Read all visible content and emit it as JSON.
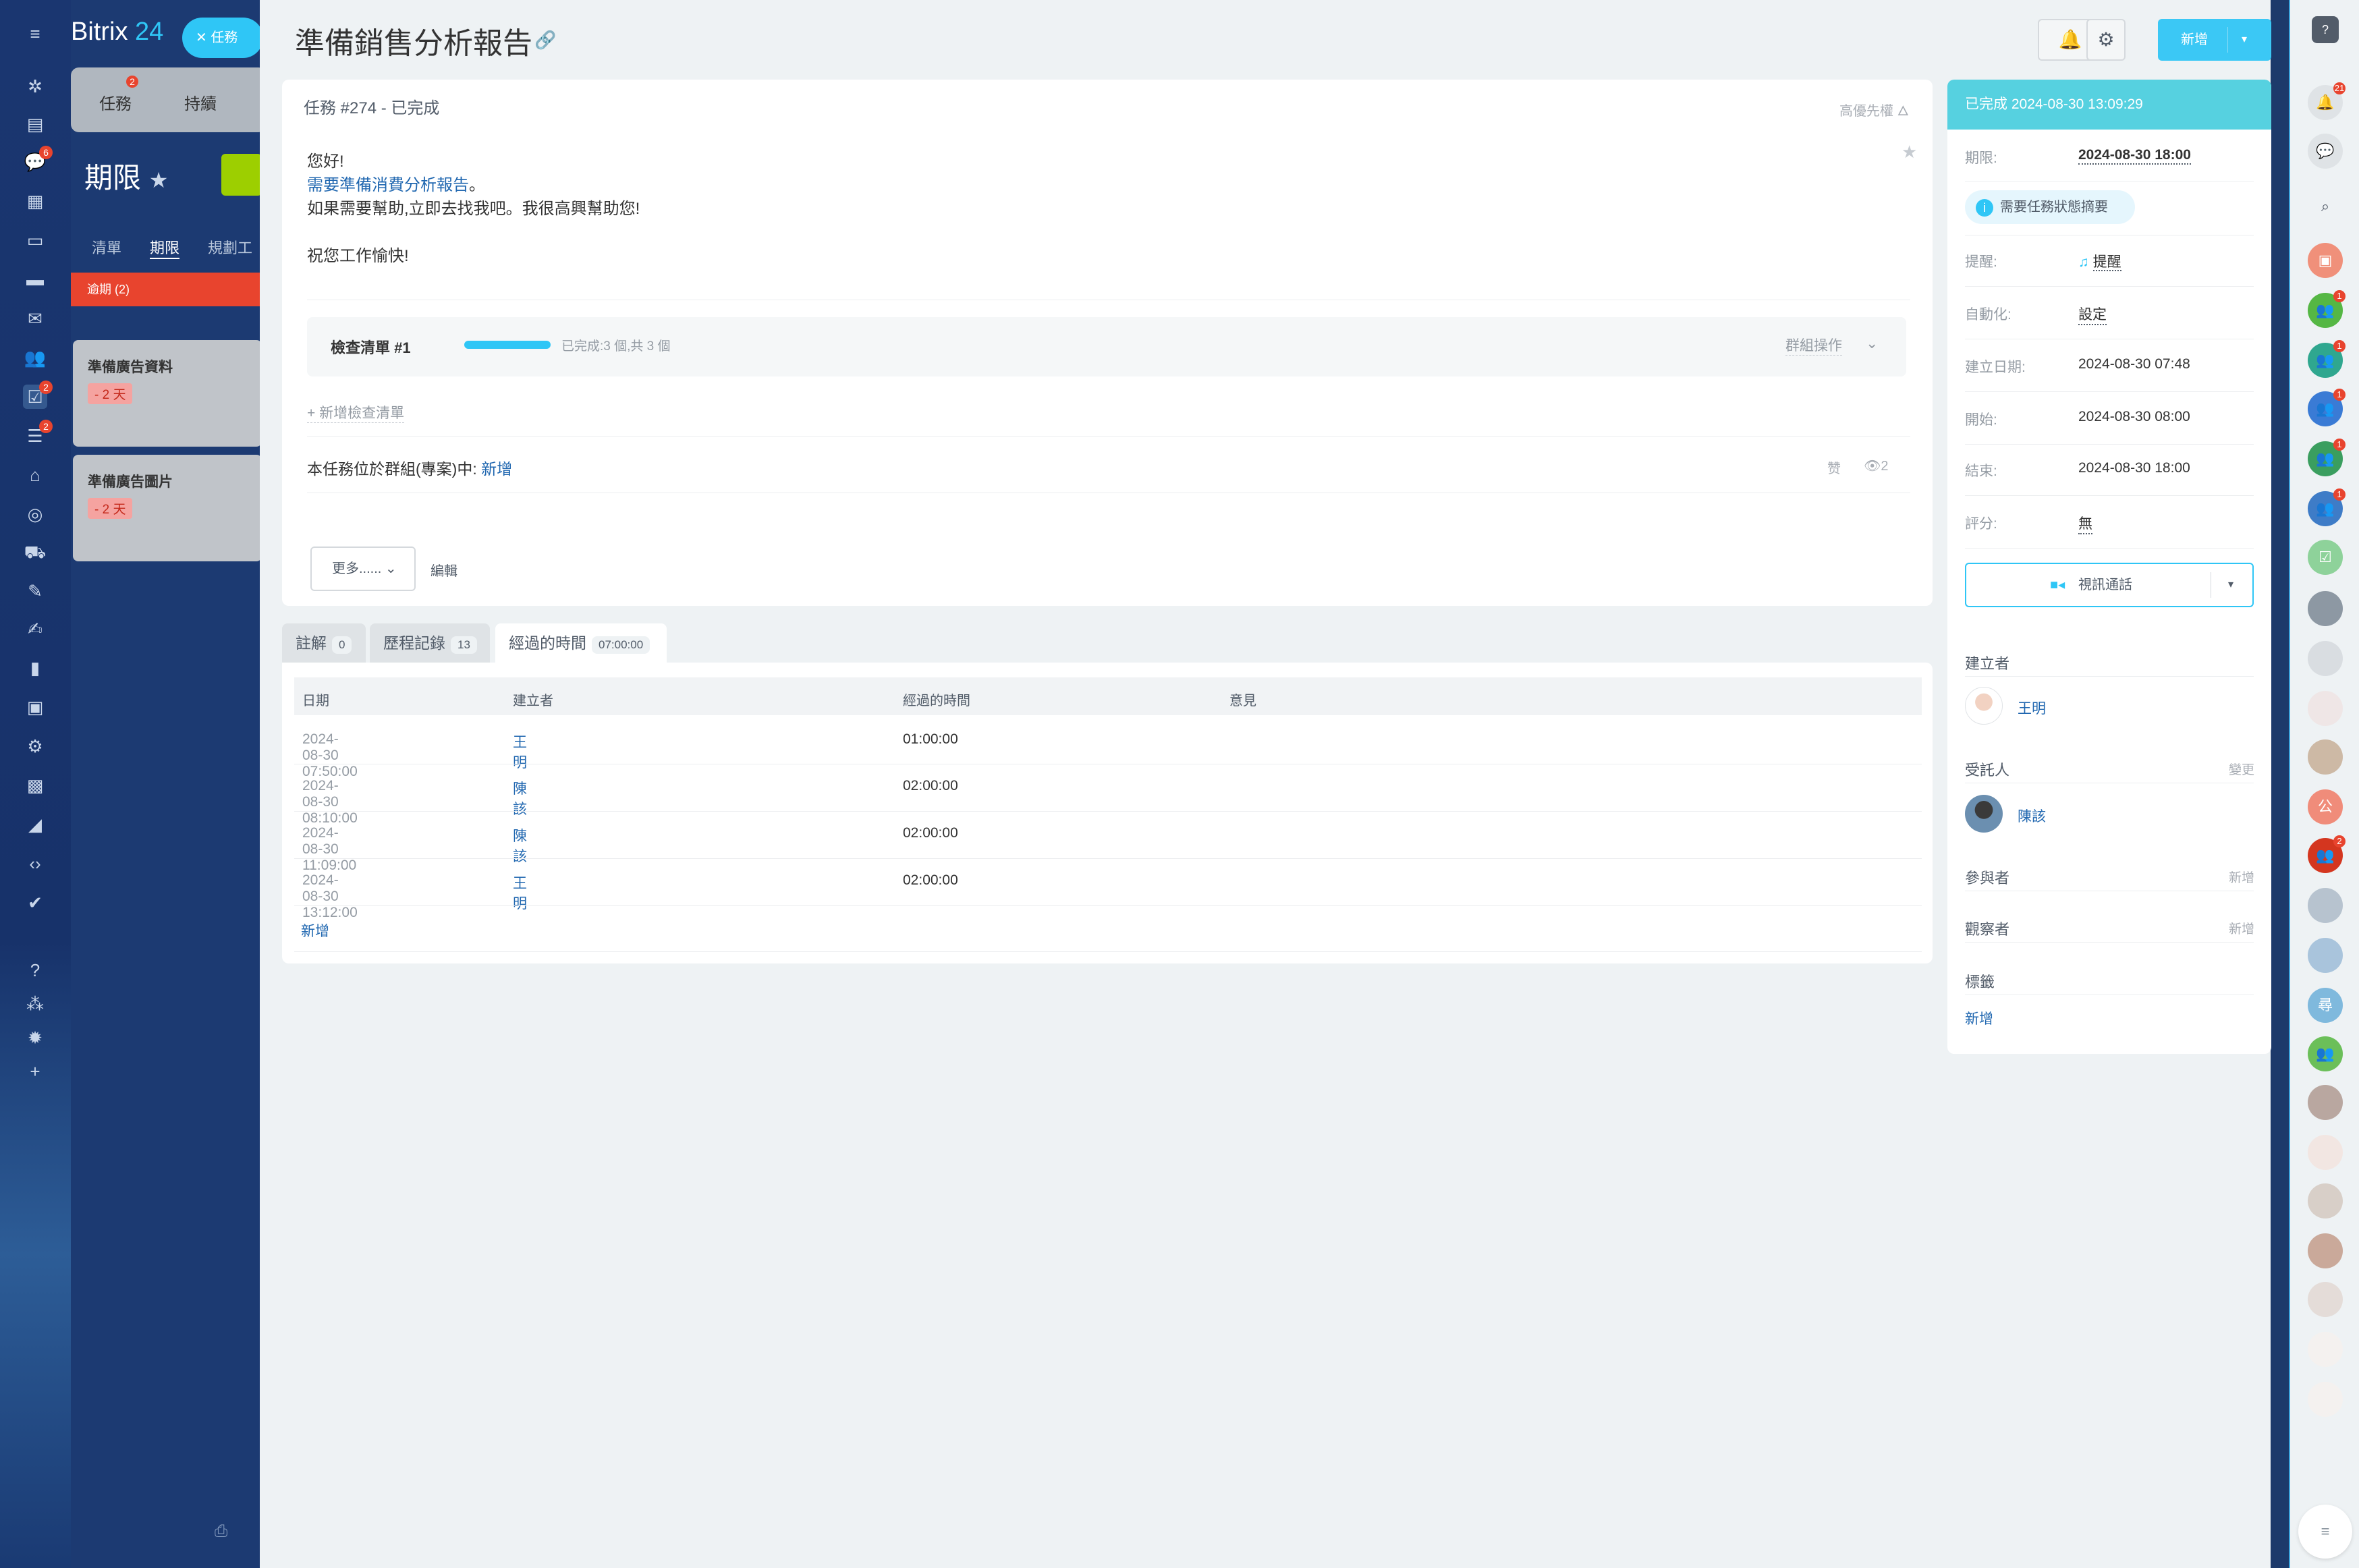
{
  "app": {
    "brand_name": "Bitrix",
    "brand_num": "24",
    "close_chip_label": "任務"
  },
  "background": {
    "tab_tasks": "任務",
    "tab_tasks_badge": "2",
    "tab_ongoing": "持續",
    "page_title": "期限",
    "subtabs": [
      "清單",
      "期限",
      "規劃工"
    ],
    "column_head": "逾期",
    "column_count": "(2)",
    "cards": [
      {
        "title": "準備廣告資料",
        "deadline": "- 2 天"
      },
      {
        "title": "準備廣告圖片",
        "deadline": "- 2 天"
      }
    ]
  },
  "leftnav": {
    "badges": {
      "chat": "6",
      "tasks": "2",
      "feed": "2"
    }
  },
  "header": {
    "title": "準備銷售分析報告",
    "new_button": "新增"
  },
  "task": {
    "head": "任務 #274 - 已完成",
    "priority": "高優先權",
    "description": {
      "greeting": "您好!",
      "link_text": "需要準備消費分析報告",
      "link_suffix": "。",
      "line3": "如果需要幫助,立即去找我吧。我很高興幫助您!",
      "line5": "祝您工作愉快!"
    },
    "checklist": {
      "title": "檢查清單 #1",
      "progress": 1.0,
      "status": "已完成:3 個,共 3 個",
      "group_action": "群組操作"
    },
    "add_checklist": "+ 新增檢查清單",
    "group_line_prefix": "本任務位於群組(專案)中: ",
    "group_link": "新增",
    "like": "赞",
    "views": "2",
    "more_button": "更多......",
    "edit_link": "編輯"
  },
  "tabs": [
    {
      "label": "註解",
      "count": "0"
    },
    {
      "label": "歷程記錄",
      "count": "13"
    },
    {
      "label": "經過的時間",
      "count": "07:00:00"
    }
  ],
  "time_table": {
    "headers": [
      "日期",
      "建立者",
      "經過的時間",
      "意見"
    ],
    "rows": [
      {
        "date": "2024-08-30 07:50:00",
        "creator": "王明",
        "elapsed": "01:00:00",
        "comment": ""
      },
      {
        "date": "2024-08-30 08:10:00",
        "creator": "陳該",
        "elapsed": "02:00:00",
        "comment": ""
      },
      {
        "date": "2024-08-30 11:09:00",
        "creator": "陳該",
        "elapsed": "02:00:00",
        "comment": ""
      },
      {
        "date": "2024-08-30 13:12:00",
        "creator": "王明",
        "elapsed": "02:00:00",
        "comment": ""
      }
    ],
    "add_link": "新增"
  },
  "sidebar": {
    "status_head": "已完成 2024-08-30 13:09:29",
    "deadline_label": "期限:",
    "deadline_value": "2024-08-30 18:00",
    "summary_chip": "需要任務狀態摘要",
    "reminder_label": "提醒:",
    "reminder_value": "提醒",
    "automation_label": "自動化:",
    "automation_value": "設定",
    "created_label": "建立日期:",
    "created_value": "2024-08-30 07:48",
    "start_label": "開始:",
    "start_value": "2024-08-30 08:00",
    "end_label": "結束:",
    "end_value": "2024-08-30 18:00",
    "rating_label": "評分:",
    "rating_value": "無",
    "video_call": "視訊通話",
    "creator_section": "建立者",
    "creator_name": "王明",
    "assignee_section": "受託人",
    "assignee_change": "變更",
    "assignee_name": "陳該",
    "participants_section": "參與者",
    "participants_add": "新增",
    "observers_section": "觀察者",
    "observers_add": "新增",
    "tags_section": "標籤",
    "tags_add": "新增"
  },
  "rail": {
    "notifications_badge": "21",
    "group_badges": [
      "1",
      "1",
      "1",
      "1",
      "1"
    ],
    "avatar_letters": [
      "公",
      "尋"
    ],
    "group_red_badge": "2"
  },
  "colors": {
    "accent": "#2fc6f6",
    "link": "#2067b0",
    "overdue": "#e8442e",
    "done_header": "#56d1e0"
  }
}
